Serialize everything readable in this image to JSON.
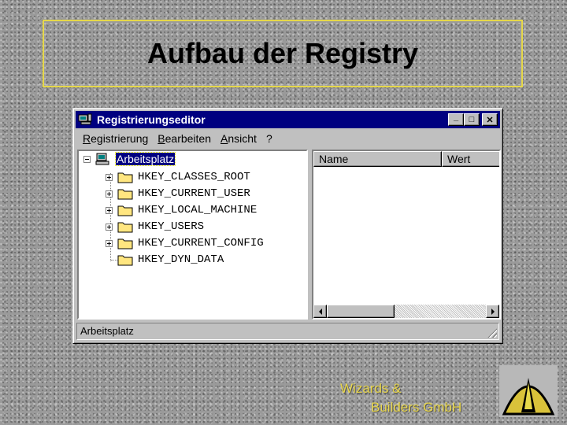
{
  "slide": {
    "title": "Aufbau der Registry"
  },
  "window": {
    "title": "Registrierungseditor",
    "controls": {
      "minimize": "_",
      "maximize": "□",
      "close": "✕"
    },
    "menu": [
      {
        "label": "Registrierung",
        "accel": "R"
      },
      {
        "label": "Bearbeiten",
        "accel": "B"
      },
      {
        "label": "Ansicht",
        "accel": "A"
      },
      {
        "label": "?"
      }
    ],
    "tree": {
      "root": "Arbeitsplatz",
      "keys": [
        {
          "label": "HKEY_CLASSES_ROOT",
          "expandable": true
        },
        {
          "label": "HKEY_CURRENT_USER",
          "expandable": true
        },
        {
          "label": "HKEY_LOCAL_MACHINE",
          "expandable": true
        },
        {
          "label": "HKEY_USERS",
          "expandable": true
        },
        {
          "label": "HKEY_CURRENT_CONFIG",
          "expandable": true
        },
        {
          "label": "HKEY_DYN_DATA",
          "expandable": false
        }
      ]
    },
    "columns": [
      "Name",
      "Wert"
    ],
    "status": "Arbeitsplatz",
    "colors": {
      "titlebar": "#000080",
      "face": "#c0c0c0"
    }
  },
  "footer": {
    "line1": "Wizards &",
    "line2": "Builders GmbH",
    "logo_icon": "wizard-hat-logo"
  }
}
